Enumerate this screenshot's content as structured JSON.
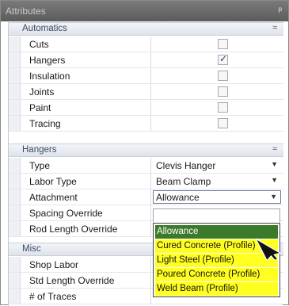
{
  "window": {
    "title": "Attributes",
    "pin_glyph": "ᵖ"
  },
  "categories": {
    "automatics": {
      "label": "Automatics",
      "chevron": "≈"
    },
    "hangers": {
      "label": "Hangers",
      "chevron": "≈"
    },
    "misc": {
      "label": "Misc"
    }
  },
  "automatics_rows": [
    {
      "name": "Cuts",
      "checked": false
    },
    {
      "name": "Hangers",
      "checked": true
    },
    {
      "name": "Insulation",
      "checked": false
    },
    {
      "name": "Joints",
      "checked": false
    },
    {
      "name": "Paint",
      "checked": false
    },
    {
      "name": "Tracing",
      "checked": false
    }
  ],
  "hangers_rows": {
    "type": {
      "name": "Type",
      "value": "Clevis Hanger"
    },
    "labor_type": {
      "name": "Labor Type",
      "value": "Beam Clamp"
    },
    "attachment": {
      "name": "Attachment",
      "value": "Allowance"
    },
    "spacing_override": {
      "name": "Spacing Override",
      "value": ""
    },
    "rod_length_override": {
      "name": "Rod Length Override",
      "value": ""
    }
  },
  "misc_rows": [
    {
      "name": "Shop Labor"
    },
    {
      "name": "Std Length Override"
    },
    {
      "name": "# of Traces"
    }
  ],
  "dropdown": {
    "selected_index": 0,
    "options": [
      "Allowance",
      "Cured Concrete (Profile)",
      "Light Steel (Profile)",
      "Poured Concrete (Profile)",
      "Weld Beam (Profile)"
    ]
  },
  "colors": {
    "highlight_yellow": "#ffff20",
    "selected_green": "#3b7a2a",
    "title_bar": "#6a6a6a"
  },
  "icons": {
    "checkbox": "checkbox-icon",
    "dropdown_arrow": "dropdown-arrow-icon",
    "collapse": "collapse-chevron-icon",
    "pin": "pin-icon",
    "cursor": "mouse-pointer-icon"
  }
}
